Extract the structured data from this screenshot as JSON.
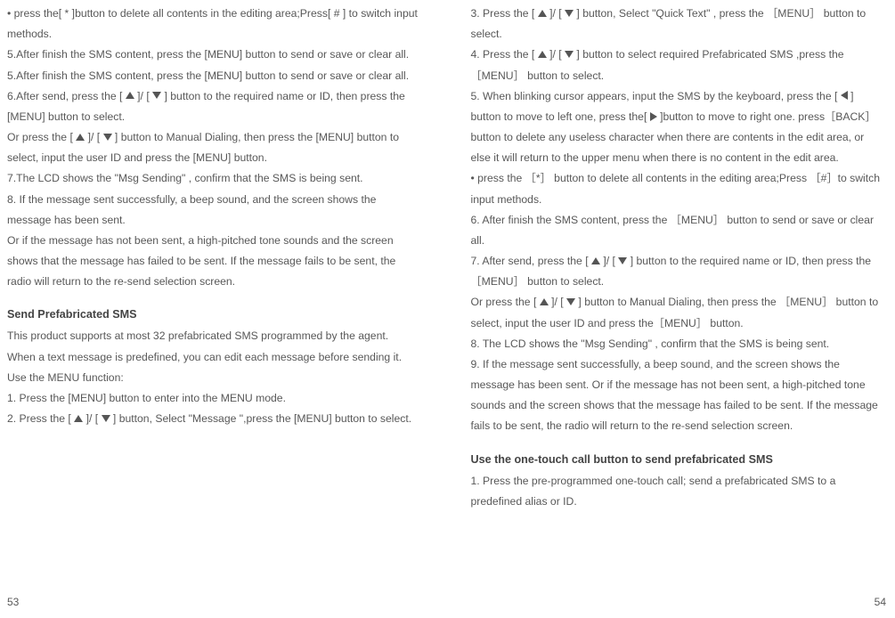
{
  "icons": {
    "up": "▲",
    "down": "▼",
    "left": "◀",
    "right": "▶"
  },
  "left_page": {
    "lines": [
      {
        "parts": [
          "• press the[ * ]button to delete all contents in the editing area;Press[ # ] to switch input methods."
        ]
      },
      {
        "parts": [
          "5.After finish the SMS content, press the [MENU] button to send or save or clear all."
        ]
      },
      {
        "parts": [
          "5.After finish the SMS content, press the [MENU] button to send or save or clear all."
        ]
      },
      {
        "parts": [
          "6.After send, press the [ ",
          {
            "icon": "up"
          },
          " ]/ [ ",
          {
            "icon": "down"
          },
          " ] button to the required name or ID, then press the [MENU] button to select."
        ]
      },
      {
        "parts": [
          "Or press the [ ",
          {
            "icon": "up"
          },
          " ]/ [ ",
          {
            "icon": "down"
          },
          " ] button to Manual Dialing, then press the [MENU] button to select, input the user ID and press the [MENU] button."
        ]
      },
      {
        "parts": [
          "7.The LCD shows the \"Msg  Sending\" , confirm that the SMS is being sent."
        ]
      },
      {
        "parts": [
          "8. If the message sent successfully, a beep sound, and the screen shows the message has been sent."
        ]
      },
      {
        "parts": [
          "Or if the message has not been sent, a high-pitched tone sounds and the screen shows that the message has failed to be sent. If the message fails to be sent, the radio will return to the re-send selection screen."
        ]
      },
      {
        "heading": "Send Prefabricated SMS"
      },
      {
        "parts": [
          "This product supports at most 32 prefabricated SMS programmed by the agent."
        ]
      },
      {
        "parts": [
          "When a text message is predefined, you can edit each message before sending it."
        ]
      },
      {
        "parts": [
          "Use the MENU function:"
        ]
      },
      {
        "parts": [
          "1. Press the [MENU] button to enter into the MENU mode."
        ]
      },
      {
        "parts": [
          "2. Press the [ ",
          {
            "icon": "up"
          },
          " ]/ [ ",
          {
            "icon": "down"
          },
          " ] button, Select \"Message \",press the [MENU] button to select."
        ]
      }
    ],
    "pagenum": "53"
  },
  "right_page": {
    "lines": [
      {
        "parts": [
          "3. Press the [ ",
          {
            "icon": "up"
          },
          " ]/ [ ",
          {
            "icon": "down"
          },
          " ] button, Select \"Quick Text\" , press the ［MENU］ button to select."
        ]
      },
      {
        "parts": [
          "4. Press the [ ",
          {
            "icon": "up"
          },
          " ]/ [ ",
          {
            "icon": "down"
          },
          " ] button to select required Prefabricated SMS ,press the ［MENU］ button to select."
        ]
      },
      {
        "parts": [
          "5. When blinking cursor appears, input the SMS by the keyboard, press the [ ",
          {
            "icon": "left"
          },
          " ] button to move to left one, press the[ ",
          {
            "icon": "right"
          },
          " ]button to move to right one. press［BACK］ button to delete any useless character when there are contents in the edit area, or else it will return to the upper menu when there is no content in the edit area."
        ]
      },
      {
        "parts": [
          "• press the ［*］ button to delete all contents in the editing area;Press ［#］to switch input methods."
        ]
      },
      {
        "parts": [
          "6. After finish the SMS content, press the ［MENU］ button to send or save or clear all."
        ]
      },
      {
        "parts": [
          "7. After send, press the [ ",
          {
            "icon": "up"
          },
          " ]/ [ ",
          {
            "icon": "down"
          },
          " ] button to the required name or ID, then press the ［MENU］ button to select."
        ]
      },
      {
        "parts": [
          "Or press the [ ",
          {
            "icon": "up"
          },
          " ]/ [ ",
          {
            "icon": "down"
          },
          " ] button to Manual Dialing, then press the ［MENU］ button to select, input the user ID and press the［MENU］ button."
        ]
      },
      {
        "parts": [
          "8. The LCD shows the \"Msg  Sending\" , confirm that the SMS is being sent."
        ]
      },
      {
        "parts": [
          "9.  If the message sent successfully, a beep sound, and the screen shows the message has been sent. Or if the message has not been sent, a high-pitched tone sounds and the screen shows that the message has failed to be sent. If the message fails to be sent, the radio will return to the re-send selection screen."
        ]
      },
      {
        "heading": "Use the one-touch call button to send prefabricated SMS"
      },
      {
        "parts": [
          "1. Press the pre-programmed one-touch call; send a prefabricated SMS to a predefined alias or ID."
        ]
      }
    ],
    "pagenum": "54"
  }
}
